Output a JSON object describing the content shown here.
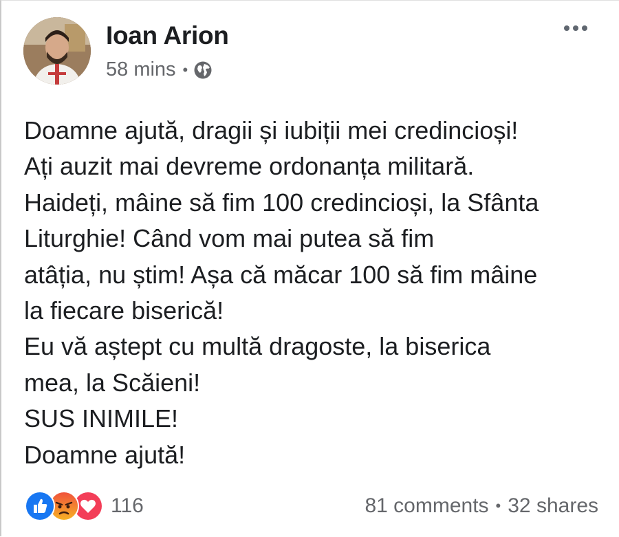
{
  "post": {
    "author": "Ioan Arion",
    "time": "58 mins",
    "separator": "•",
    "privacy_icon": "globe-icon",
    "more_icon": "more-options-icon",
    "body_lines": [
      "Doamne ajută, dragii și iubiții mei credincioși!",
      "Ați auzit mai devreme ordonanța militară.",
      "Haideți, mâine să fim 100 credincioși, la Sfânta",
      "Liturghie! Când vom mai putea să fim",
      "atâția, nu știm! Așa că măcar 100 să fim mâine",
      "la fiecare biserică!",
      "Eu vă aștept cu multă dragoste, la biserica",
      "mea, la Scăieni!",
      "SUS INIMILE!",
      "Doamne ajută!"
    ]
  },
  "footer": {
    "reaction_icons": [
      "like-icon",
      "angry-icon",
      "love-icon"
    ],
    "reaction_count": "116",
    "comments": "81 comments",
    "separator": "•",
    "shares": "32 shares"
  },
  "colors": {
    "like": "#1877f2",
    "angry": "#f0533c",
    "love": "#f33e58",
    "muted_text": "#65676b"
  }
}
